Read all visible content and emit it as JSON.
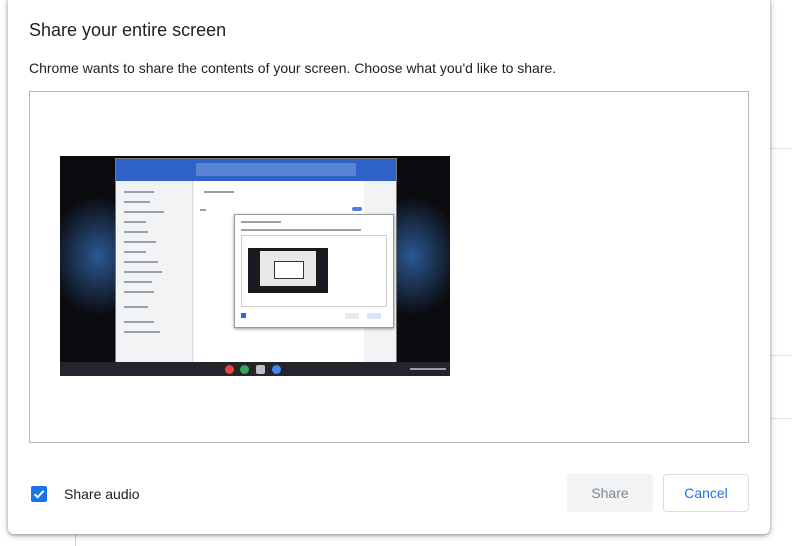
{
  "dialog": {
    "title": "Share your entire screen",
    "description": "Chrome wants to share the contents of your screen. Choose what you'd like to share.",
    "share_audio_label": "Share audio",
    "share_audio_checked": true,
    "share_button": "Share",
    "cancel_button": "Cancel"
  },
  "colors": {
    "accent": "#1a73e8",
    "disabled_button_bg": "#f1f3f4",
    "disabled_button_text": "#80868b"
  }
}
